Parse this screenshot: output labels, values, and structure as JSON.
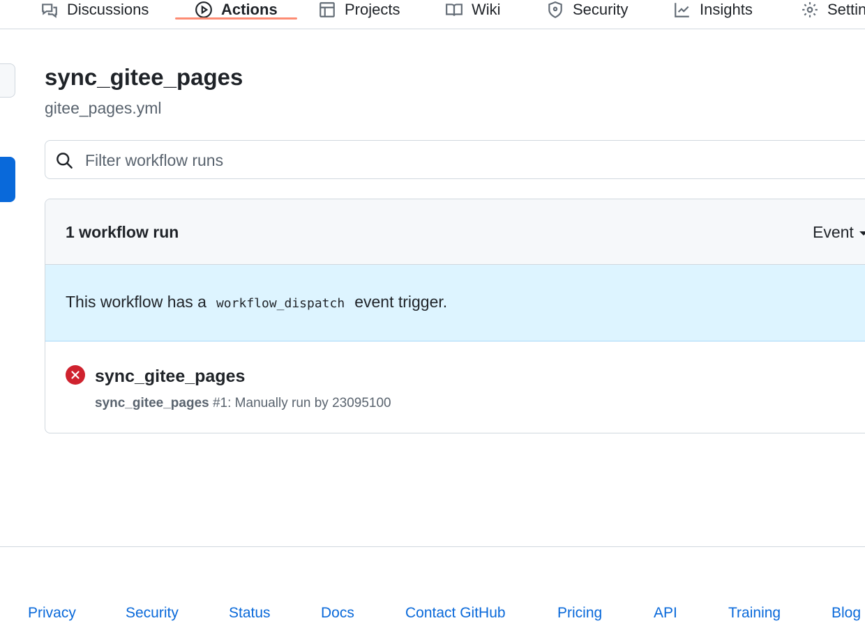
{
  "repo_nav": {
    "items": [
      {
        "label": "Discussions",
        "icon": "comment-discussion-icon",
        "selected": false
      },
      {
        "label": "Actions",
        "icon": "play-icon",
        "selected": true
      },
      {
        "label": "Projects",
        "icon": "table-icon",
        "selected": false
      },
      {
        "label": "Wiki",
        "icon": "book-icon",
        "selected": false
      },
      {
        "label": "Security",
        "icon": "shield-icon",
        "selected": false
      },
      {
        "label": "Insights",
        "icon": "graph-icon",
        "selected": false
      },
      {
        "label": "Settings",
        "icon": "gear-icon",
        "selected": false
      }
    ],
    "selected_underline_color": "#fd8c73"
  },
  "workflow": {
    "name": "sync_gitee_pages",
    "file": "gitee_pages.yml"
  },
  "search": {
    "placeholder": "Filter workflow runs",
    "value": ""
  },
  "runs": {
    "count_label": "1 workflow run",
    "event_filter_label": "Event",
    "dispatch_notice": {
      "prefix": "This workflow has a",
      "code": "workflow_dispatch",
      "suffix": "event trigger."
    },
    "items": [
      {
        "title": "sync_gitee_pages",
        "status": "failure",
        "status_color": "#cf222e",
        "workflow_name": "sync_gitee_pages",
        "detail": "#1: Manually run by 23095100"
      }
    ]
  },
  "footer": {
    "links": [
      "Privacy",
      "Security",
      "Status",
      "Docs",
      "Contact GitHub",
      "Pricing",
      "API",
      "Training",
      "Blog"
    ]
  },
  "colors": {
    "accent": "#0969da",
    "banner_bg": "#ddf4ff",
    "header_bg": "#f6f8fa"
  }
}
